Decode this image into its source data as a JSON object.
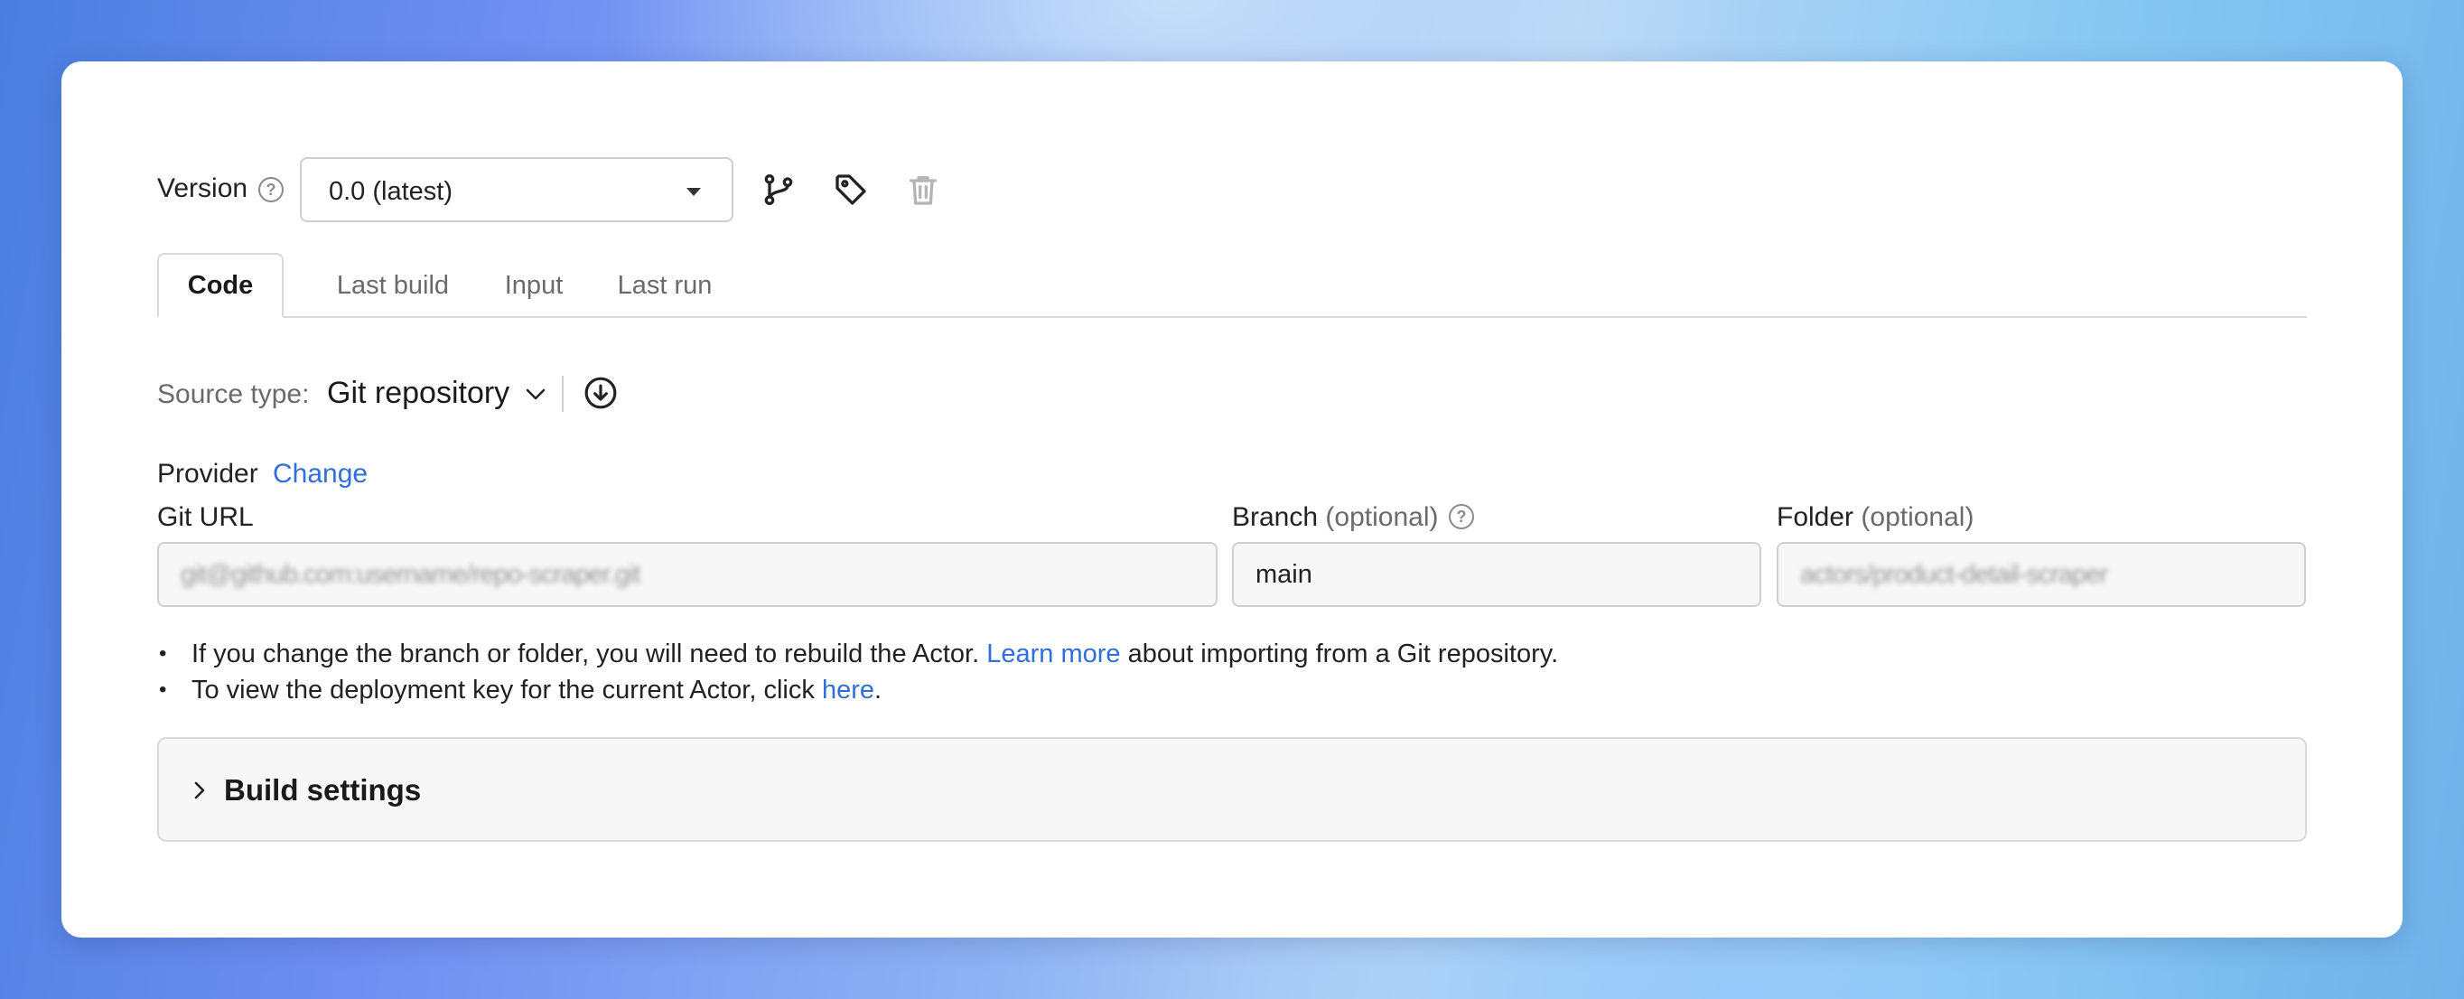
{
  "version": {
    "label": "Version",
    "selected": "0.0 (latest)"
  },
  "tabs": [
    {
      "label": "Code",
      "active": true
    },
    {
      "label": "Last build",
      "active": false
    },
    {
      "label": "Input",
      "active": false
    },
    {
      "label": "Last run",
      "active": false
    }
  ],
  "source": {
    "label": "Source type:",
    "value": "Git repository"
  },
  "provider": {
    "label": "Provider",
    "change_link": "Change"
  },
  "fields": {
    "git_url": {
      "label": "Git URL",
      "value": "git@github.com:username/repo-scraper.git"
    },
    "branch": {
      "label": "Branch",
      "optional": "(optional)",
      "value": "main"
    },
    "folder": {
      "label": "Folder",
      "optional": "(optional)",
      "value": "actors/product-detail-scraper"
    }
  },
  "notes": {
    "line1_before": "If you change the branch or folder, you will need to rebuild the Actor.",
    "line1_link": "Learn more",
    "line1_after": "about importing from a Git repository.",
    "line2_before": "To view the deployment key for the current Actor, click",
    "line2_link": "here",
    "line2_after": "."
  },
  "build_settings": {
    "title": "Build settings"
  },
  "colors": {
    "link": "#2f6fd8",
    "border": "#cfcfcf",
    "field_bg": "#f7f7f7"
  },
  "icons": [
    "help-icon",
    "chevron-down-icon",
    "git-branch-icon",
    "tag-icon",
    "trash-icon",
    "download-icon",
    "chevron-right-icon"
  ]
}
